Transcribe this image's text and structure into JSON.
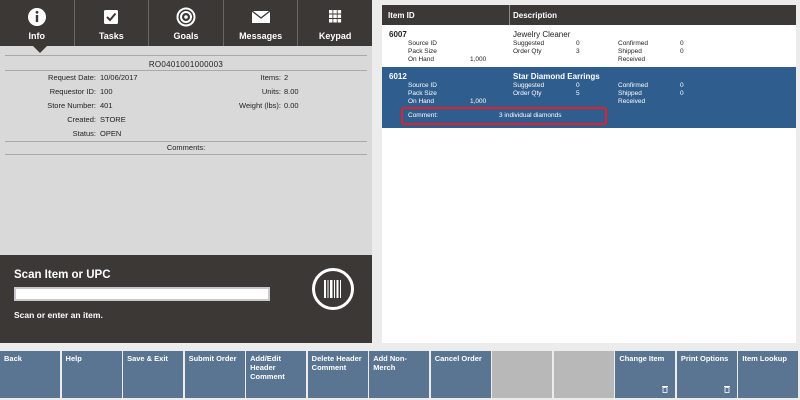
{
  "nav": {
    "items": [
      {
        "label": "Info",
        "icon": "info-icon"
      },
      {
        "label": "Tasks",
        "icon": "checkbox-icon"
      },
      {
        "label": "Goals",
        "icon": "target-icon"
      },
      {
        "label": "Messages",
        "icon": "envelope-icon"
      },
      {
        "label": "Keypad",
        "icon": "keypad-icon"
      }
    ]
  },
  "order": {
    "id": "RO0401001000003",
    "request_date_label": "Request Date:",
    "request_date": "10/06/2017",
    "requestor_id_label": "Requestor ID:",
    "requestor_id": "100",
    "store_number_label": "Store Number:",
    "store_number": "401",
    "created_label": "Created:",
    "created": "STORE",
    "status_label": "Status:",
    "status": "OPEN",
    "items_label": "Items:",
    "items": "2",
    "units_label": "Units:",
    "units": "8.00",
    "weight_label": "Weight (lbs):",
    "weight": "0.00",
    "comments_label": "Comments:"
  },
  "scan": {
    "title": "Scan Item or UPC",
    "input_value": "",
    "hint": "Scan or enter an item."
  },
  "grid": {
    "col_item_id": "Item ID",
    "col_description": "Description",
    "items": [
      {
        "id": "6007",
        "description": "Jewelry Cleaner",
        "source_id_label": "Source ID",
        "pack_size_label": "Pack Size",
        "on_hand_label": "On Hand",
        "on_hand": "1,000",
        "suggested_label": "Suggested",
        "suggested": "0",
        "order_qty_label": "Order Qty",
        "order_qty": "3",
        "confirmed_label": "Confirmed",
        "confirmed": "0",
        "shipped_label": "Shipped",
        "shipped": "0",
        "received_label": "Received"
      },
      {
        "id": "6012",
        "description": "Star Diamond Earrings",
        "source_id_label": "Source ID",
        "pack_size_label": "Pack Size",
        "on_hand_label": "On Hand",
        "on_hand": "1,000",
        "suggested_label": "Suggested",
        "suggested": "0",
        "order_qty_label": "Order Qty",
        "order_qty": "5",
        "confirmed_label": "Confirmed",
        "confirmed": "0",
        "shipped_label": "Shipped",
        "shipped": "0",
        "received_label": "Received",
        "comment_label": "Comment:",
        "comment": "3 individual diamonds"
      }
    ]
  },
  "actions": [
    {
      "label": "Back",
      "enabled": true
    },
    {
      "label": "Help",
      "enabled": true
    },
    {
      "label": "Save & Exit",
      "enabled": true
    },
    {
      "label": "Submit Order",
      "enabled": true
    },
    {
      "label": "Add/Edit Header Comment",
      "enabled": true
    },
    {
      "label": "Delete Header Comment",
      "enabled": true
    },
    {
      "label": "Add Non-Merch",
      "enabled": true
    },
    {
      "label": "Cancel Order",
      "enabled": true
    },
    {
      "label": "",
      "enabled": false
    },
    {
      "label": "",
      "enabled": false
    },
    {
      "label": "Change Item",
      "enabled": true,
      "icon": "trash-icon"
    },
    {
      "label": "Print Options",
      "enabled": true,
      "icon": "trash-icon"
    },
    {
      "label": "Item Lookup",
      "enabled": true
    }
  ],
  "colors": {
    "dark_panel": "#3b3835",
    "selected_row": "#2f5d8e",
    "action_button": "#5a7592",
    "highlight": "#e0202a"
  }
}
